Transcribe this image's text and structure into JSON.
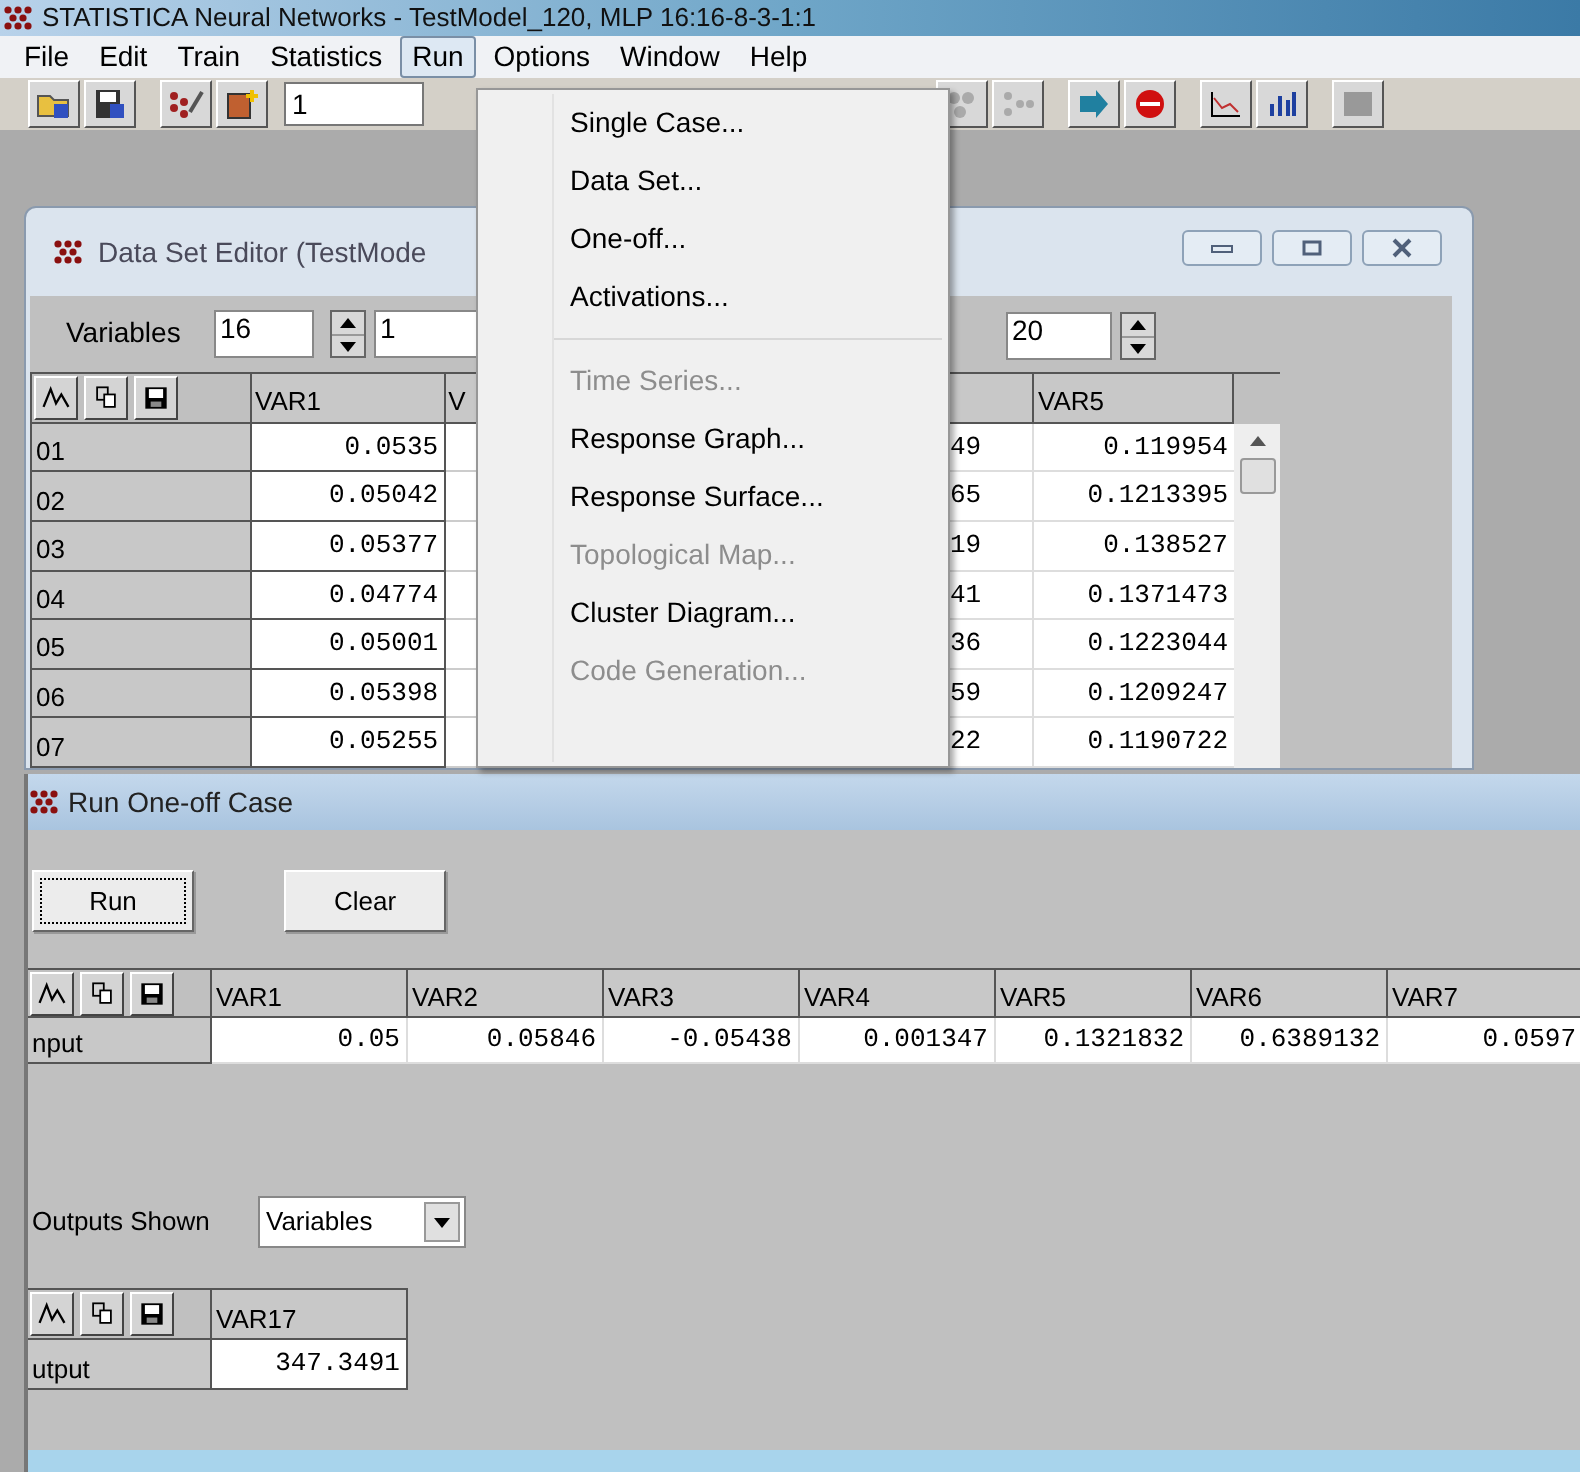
{
  "window": {
    "title": "STATISTICA Neural Networks - TestModel_120, MLP 16:16-8-3-1:1"
  },
  "menu_bar": [
    {
      "label": "File",
      "selected": false
    },
    {
      "label": "Edit",
      "selected": false
    },
    {
      "label": "Train",
      "selected": false
    },
    {
      "label": "Statistics",
      "selected": false
    },
    {
      "label": "Run",
      "selected": true
    },
    {
      "label": "Options",
      "selected": false
    },
    {
      "label": "Window",
      "selected": false
    },
    {
      "label": "Help",
      "selected": false
    }
  ],
  "toolbar": {
    "field_value": "1"
  },
  "run_menu": [
    {
      "kind": "item",
      "label": "Single Case...",
      "disabled": false
    },
    {
      "kind": "item",
      "label": "Data Set...",
      "disabled": false
    },
    {
      "kind": "item",
      "label": "One-off...",
      "disabled": false
    },
    {
      "kind": "item",
      "label": "Activations...",
      "disabled": false
    },
    {
      "kind": "separator"
    },
    {
      "kind": "item",
      "label": "Time Series...",
      "disabled": true
    },
    {
      "kind": "item",
      "label": "Response Graph...",
      "disabled": false
    },
    {
      "kind": "item",
      "label": "Response Surface...",
      "disabled": false
    },
    {
      "kind": "item",
      "label": "Topological Map...",
      "disabled": true
    },
    {
      "kind": "item",
      "label": "Cluster Diagram...",
      "disabled": false
    },
    {
      "kind": "item",
      "label": "Code Generation...",
      "disabled": true
    }
  ],
  "data_set_editor": {
    "title": "Data Set Editor (TestMode",
    "variables_label": "Variables",
    "variables_value": "16",
    "first_value": "1",
    "last_value": "20",
    "columns": {
      "var1": "VAR1",
      "column_2": "V",
      "var5": "VAR5"
    },
    "rows": [
      {
        "label": "01",
        "var1": "0.0535",
        "column_4": "49",
        "var5": "0.119954"
      },
      {
        "label": "02",
        "var1": "0.05042",
        "column_4": "65",
        "var5": "0.1213395"
      },
      {
        "label": "03",
        "var1": "0.05377",
        "column_4": "19",
        "var5": "0.138527"
      },
      {
        "label": "04",
        "var1": "0.04774",
        "column_4": "41",
        "var5": "0.1371473"
      },
      {
        "label": "05",
        "var1": "0.05001",
        "column_4": "36",
        "var5": "0.1223044"
      },
      {
        "label": "06",
        "var1": "0.05398",
        "column_4": "59",
        "var5": "0.1209247"
      },
      {
        "label": "07",
        "var1": "0.05255",
        "column_4": "22",
        "var5": "0.1190722"
      }
    ]
  },
  "one_off": {
    "title": "Run One-off Case",
    "buttons": [
      {
        "label": "Run",
        "focused": true
      },
      {
        "label": "Clear",
        "focused": false
      }
    ],
    "input_table": {
      "columns": [
        "VAR1",
        "VAR2",
        "VAR3",
        "VAR4",
        "VAR5",
        "VAR6",
        "VAR7"
      ],
      "row_label": "nput",
      "values": [
        "0.05",
        "0.05846",
        "-0.05438",
        "0.001347",
        "0.1321832",
        "0.6389132",
        "0.0597"
      ]
    },
    "outputs_shown": {
      "label": "Outputs Shown",
      "value": "Variables"
    },
    "output_table": {
      "columns": [
        "VAR17"
      ],
      "row_label": "utput",
      "values": [
        "347.3491"
      ]
    }
  }
}
